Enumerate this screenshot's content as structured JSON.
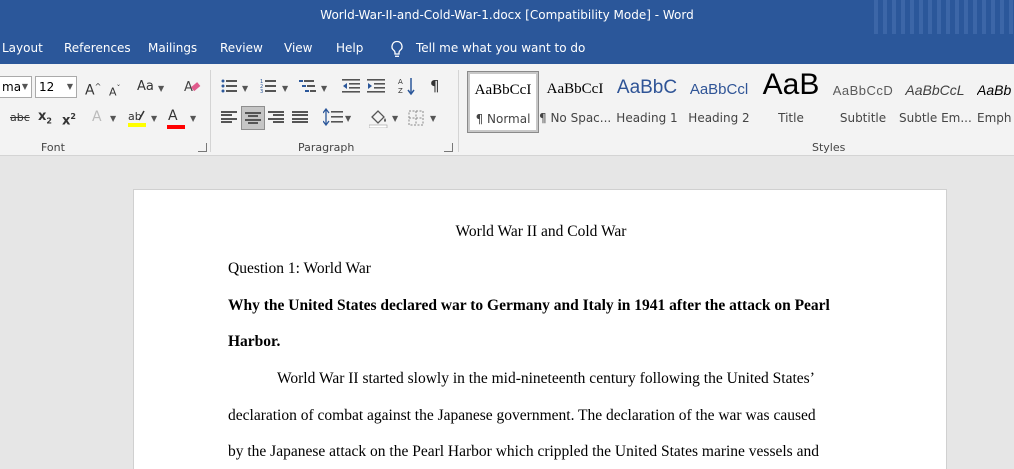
{
  "window": {
    "title": "World-War-II-and-Cold-War-1.docx [Compatibility Mode]  -  Word"
  },
  "menu": {
    "tabs": [
      "Layout",
      "References",
      "Mailings",
      "Review",
      "View",
      "Help"
    ],
    "tell_me": "Tell me what you want to do"
  },
  "ribbon": {
    "font": {
      "name": "ma",
      "size": "12",
      "grow": "A",
      "shrink": "A",
      "change_case": "Aa",
      "strikethrough": "abc",
      "subscript": "x",
      "subscript_mark": "2",
      "superscript": "x",
      "superscript_mark": "2",
      "text_effects": "A",
      "font_color": "A",
      "highlight_color": "#ffff00",
      "font_color_bar": "#ff0000",
      "label": "Font"
    },
    "paragraph": {
      "label": "Paragraph",
      "pilcrow": "¶"
    },
    "styles": {
      "label": "Styles",
      "items": [
        {
          "preview": "AaBbCcI",
          "name": "¶ Normal"
        },
        {
          "preview": "AaBbCcI",
          "name": "¶ No Spac..."
        },
        {
          "preview": "AaBbC",
          "name": "Heading 1"
        },
        {
          "preview": "AaBbCcl",
          "name": "Heading 2"
        },
        {
          "preview": "AaB",
          "name": "Title"
        },
        {
          "preview": "AaBbCcD",
          "name": "Subtitle"
        },
        {
          "preview": "AaBbCcL",
          "name": "Subtle Em..."
        },
        {
          "preview": "AaBb",
          "name": "Emph"
        }
      ]
    }
  },
  "document": {
    "title": "World War II and Cold War",
    "question": "Question 1: World War",
    "heading_line1": "Why the United States declared war to Germany and Italy in 1941 after the attack on Pearl",
    "heading_line2": "Harbor.",
    "body": [
      "World War II started slowly in the mid-nineteenth century following the United States’",
      "declaration of combat against the Japanese government. The declaration of the war was caused",
      "by the Japanese attack on the Pearl Harbor which crippled the United States marine vessels and"
    ]
  }
}
